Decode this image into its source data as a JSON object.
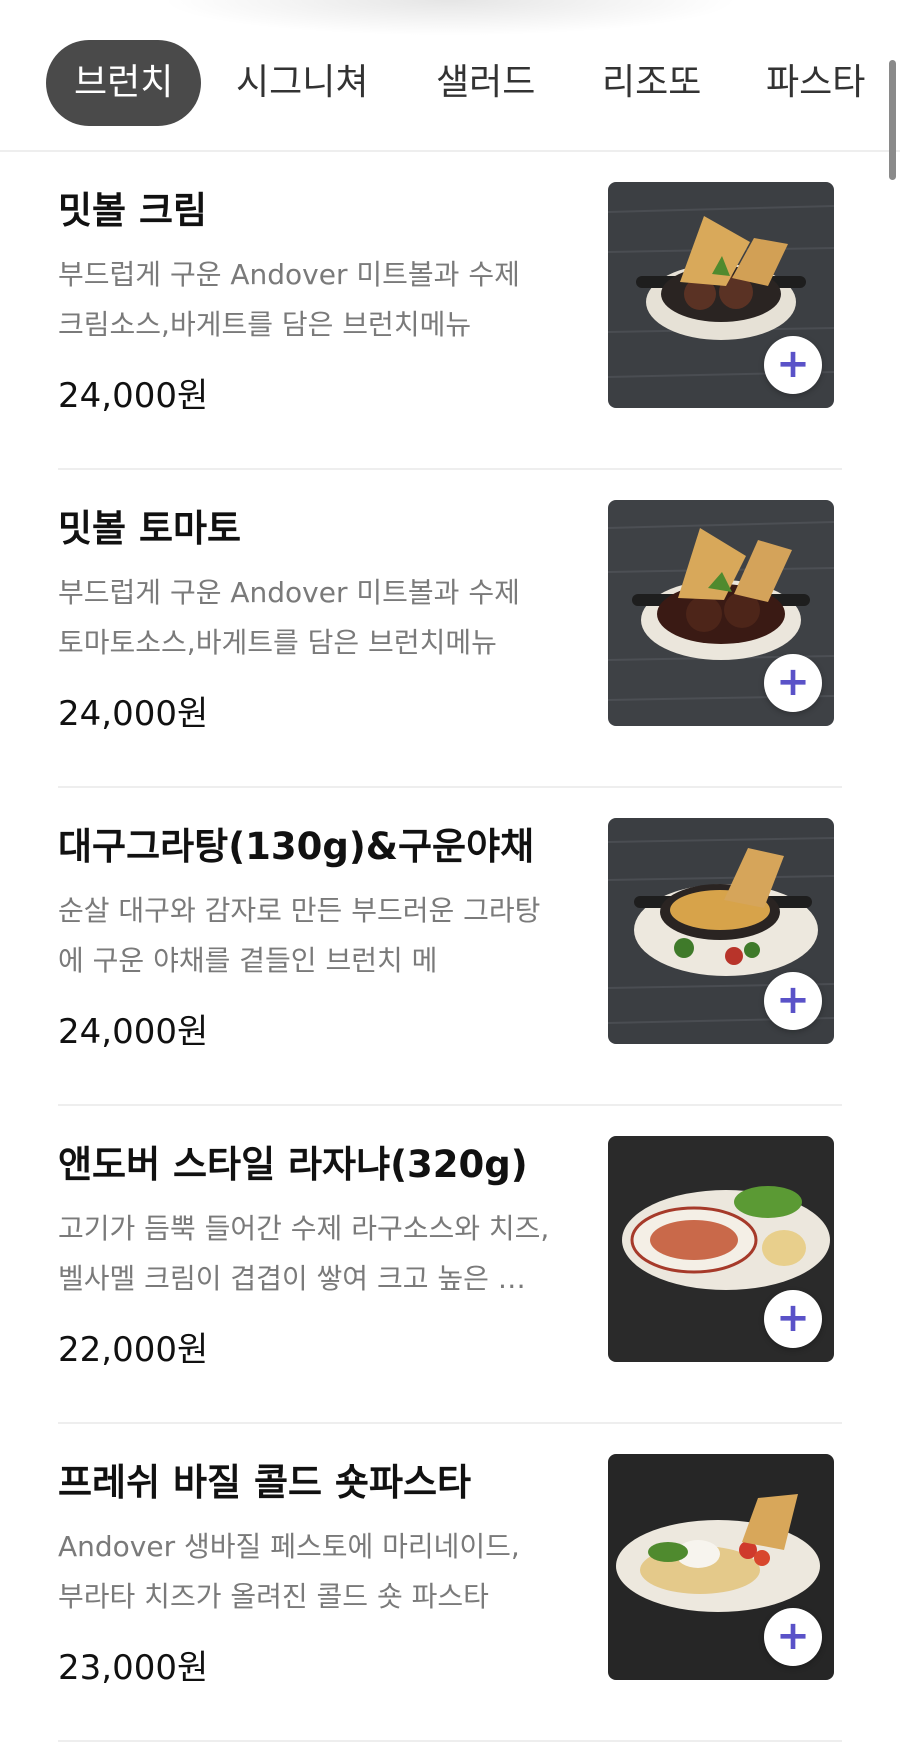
{
  "tabs": [
    {
      "label": "브런치",
      "active": true
    },
    {
      "label": "시그니쳐",
      "active": false
    },
    {
      "label": "샐러드",
      "active": false
    },
    {
      "label": "리조또",
      "active": false
    },
    {
      "label": "파스타",
      "active": false
    }
  ],
  "menu": [
    {
      "name": "밋볼 크림",
      "desc_line1": "부드럽게 구운 Andover 미트볼과 수제",
      "desc_line2": "크림소스,바게트를 담은 브런치메뉴",
      "price": "24,000원"
    },
    {
      "name": "밋볼 토마토",
      "desc_line1": "부드럽게 구운 Andover 미트볼과 수제",
      "desc_line2": "토마토소스,바게트를 담은 브런치메뉴",
      "price": "24,000원"
    },
    {
      "name": "대구그라탕(130g)&구운야채",
      "desc_line1": "순살 대구와 감자로 만든 부드러운 그라탕",
      "desc_line2": "에 구운 야채를 곁들인 브런치 메",
      "price": "24,000원"
    },
    {
      "name": "앤도버 스타일 라자냐(320g)",
      "desc_line1": "고기가 듬뿍 들어간 수제 라구소스와 치즈,",
      "desc_line2": "벨사멜 크림이 겹겹이 쌓여 크고 높은 …",
      "price": "22,000원"
    },
    {
      "name": "프레쉬 바질 콜드 숏파스타",
      "desc_line1": "Andover 생바질 페스토에 마리네이드,",
      "desc_line2": "부라타 치즈가 올려진 콜드 숏 파스타",
      "price": "23,000원"
    }
  ],
  "add_symbol": "+",
  "colors": {
    "accent": "#5a52c8",
    "active_tab_bg": "#4a4a4a",
    "desc_text": "#7a7a7a"
  }
}
